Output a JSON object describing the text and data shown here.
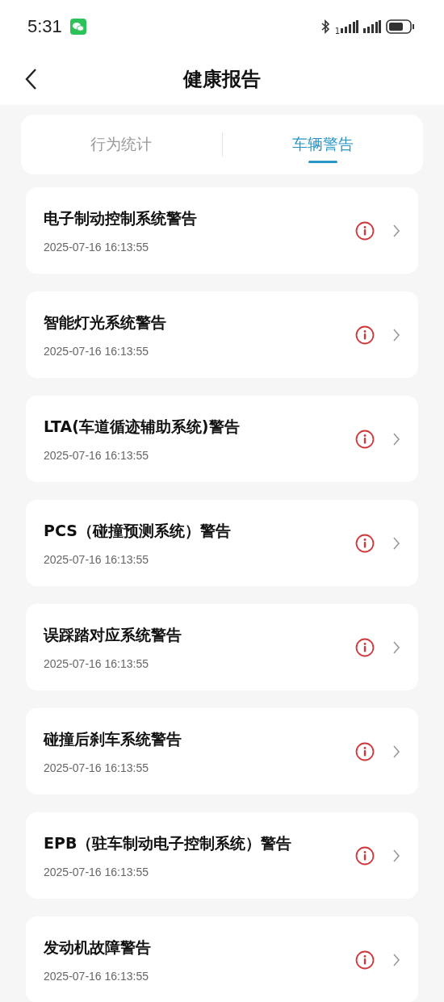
{
  "status_bar": {
    "time": "5:31",
    "sim_label": "1"
  },
  "header": {
    "title": "健康报告"
  },
  "tabs": [
    {
      "label": "行为统计",
      "selected": false
    },
    {
      "label": "车辆警告",
      "selected": true
    }
  ],
  "warnings": [
    {
      "title": "电子制动控制系统警告",
      "time": "2025-07-16 16:13:55"
    },
    {
      "title": "智能灯光系统警告",
      "time": "2025-07-16 16:13:55"
    },
    {
      "title": "LTA(车道循迹辅助系统)警告",
      "time": "2025-07-16 16:13:55"
    },
    {
      "title": "PCS（碰撞预测系统）警告",
      "time": "2025-07-16 16:13:55"
    },
    {
      "title": "误踩踏对应系统警告",
      "time": "2025-07-16 16:13:55"
    },
    {
      "title": "碰撞后刹车系统警告",
      "time": "2025-07-16 16:13:55"
    },
    {
      "title": "EPB（驻车制动电子控制系统）警告",
      "time": "2025-07-16 16:13:55"
    },
    {
      "title": "发动机故障警告",
      "time": "2025-07-16 16:13:55"
    }
  ]
}
